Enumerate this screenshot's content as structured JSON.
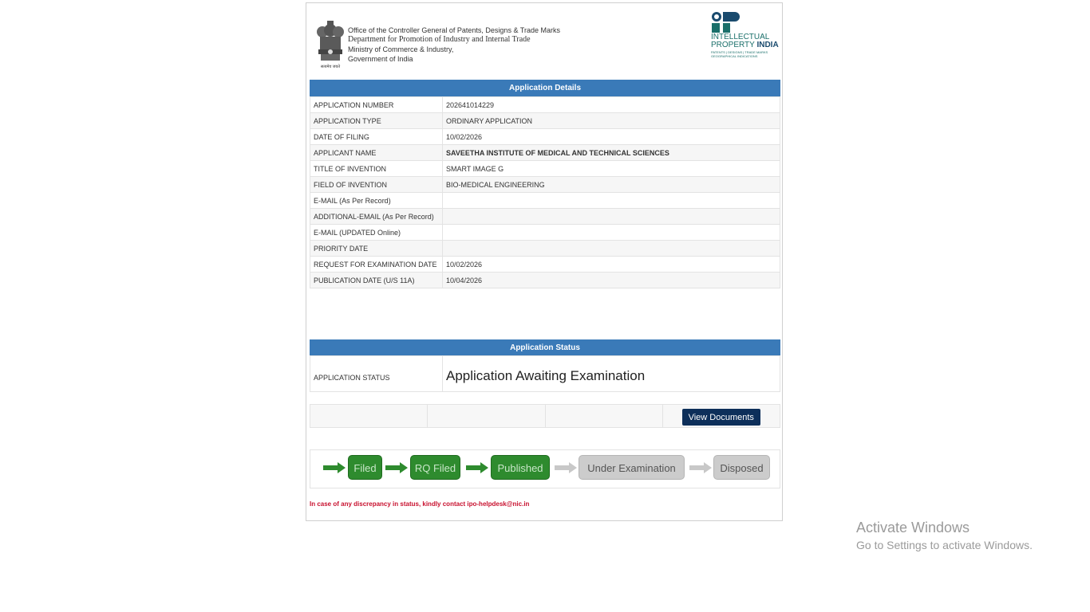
{
  "header": {
    "emblem_caption": "सत्यमेव जयते",
    "office_lines": [
      "Office of the Controller General of Patents, Designs & Trade Marks",
      "Department for Promotion of Industry and Internal Trade",
      "Ministry of Commerce & Industry,",
      "Government of India"
    ],
    "logo": {
      "line1": "INTELLECTUAL",
      "line2a": "PROPERTY ",
      "line2b": "INDIA",
      "sub1": "PATENTS | DESIGNS | TRADE MARKS",
      "sub2": "GEOGRAPHICAL INDICATIONS"
    }
  },
  "details": {
    "heading": "Application Details",
    "rows": [
      {
        "label": "APPLICATION NUMBER",
        "value": "202641014229"
      },
      {
        "label": "APPLICATION TYPE",
        "value": "ORDINARY APPLICATION"
      },
      {
        "label": "DATE OF FILING",
        "value": "10/02/2026"
      },
      {
        "label": "APPLICANT NAME",
        "value": "SAVEETHA INSTITUTE OF MEDICAL AND TECHNICAL SCIENCES"
      },
      {
        "label": "TITLE OF INVENTION",
        "value": "SMART IMAGE G"
      },
      {
        "label": "FIELD OF INVENTION",
        "value": "BIO-MEDICAL ENGINEERING"
      },
      {
        "label": "E-MAIL (As Per Record)",
        "value": ""
      },
      {
        "label": "ADDITIONAL-EMAIL (As Per Record)",
        "value": ""
      },
      {
        "label": "E-MAIL (UPDATED Online)",
        "value": ""
      },
      {
        "label": "PRIORITY DATE",
        "value": ""
      },
      {
        "label": "REQUEST FOR EXAMINATION DATE",
        "value": "10/02/2026"
      },
      {
        "label": "PUBLICATION DATE (U/S 11A)",
        "value": "10/04/2026"
      }
    ]
  },
  "status": {
    "heading": "Application Status",
    "label": "APPLICATION STATUS",
    "value": "Application Awaiting Examination"
  },
  "documents": {
    "button_label": "View Documents"
  },
  "progress": {
    "steps": [
      {
        "label": "Filed",
        "done": true
      },
      {
        "label": "RQ Filed",
        "done": true
      },
      {
        "label": "Published",
        "done": true
      },
      {
        "label": "Under Examination",
        "done": false
      },
      {
        "label": "Disposed",
        "done": false
      }
    ],
    "colors": {
      "done": "#2e8b2e",
      "pending": "#cccccc",
      "bar": "#3a7ab8"
    }
  },
  "note": "In case of any discrepancy in status, kindly contact ipo-helpdesk@nic.in",
  "watermark": {
    "title": "Activate Windows",
    "subtitle": "Go to Settings to activate Windows."
  }
}
